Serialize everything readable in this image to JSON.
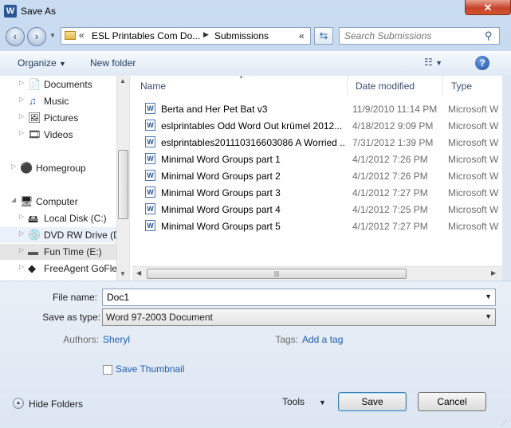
{
  "window": {
    "title": "Save As",
    "app_icon_letter": "W",
    "close_glyph": "✕"
  },
  "address_bar": {
    "chevron": "«",
    "segments": [
      "ESL Printables Com Do...",
      "Submissions"
    ],
    "arrow": "▶",
    "trailing_chevron": "«"
  },
  "search": {
    "placeholder": "Search Submissions"
  },
  "toolbar": {
    "organize_label": "Organize",
    "new_folder_label": "New folder"
  },
  "nav_pane": {
    "items": [
      {
        "label": "Documents",
        "icon": "documents-icon",
        "glyph": "📄"
      },
      {
        "label": "Music",
        "icon": "music-icon",
        "glyph": "♫"
      },
      {
        "label": "Pictures",
        "icon": "pictures-icon",
        "glyph": "🖼"
      },
      {
        "label": "Videos",
        "icon": "videos-icon",
        "glyph": "🎞"
      },
      {
        "label": "Homegroup",
        "icon": "homegroup-icon",
        "glyph": "⚫"
      },
      {
        "label": "Computer",
        "icon": "computer-icon",
        "glyph": "🖥"
      },
      {
        "label": "Local Disk (C:)",
        "icon": "disk-icon",
        "glyph": "🖴"
      },
      {
        "label": "DVD RW Drive (D",
        "icon": "dvd-icon",
        "glyph": "💿"
      },
      {
        "label": "Fun Time (E:)",
        "icon": "drive-icon",
        "glyph": "▬"
      },
      {
        "label": "FreeAgent GoFle:",
        "icon": "external-drive-icon",
        "glyph": "◆"
      }
    ]
  },
  "columns": {
    "name": "Name",
    "date": "Date modified",
    "type": "Type"
  },
  "files": [
    {
      "name": "Berta and Her Pet Bat v3",
      "date": "11/9/2010 11:14 PM",
      "type": "Microsoft W"
    },
    {
      "name": "eslprintables Odd Word Out krümel 2012...",
      "date": "4/18/2012 9:09 PM",
      "type": "Microsoft W"
    },
    {
      "name": "eslprintables201110316603086 A Worried ...",
      "date": "7/31/2012 1:39 PM",
      "type": "Microsoft W"
    },
    {
      "name": "Minimal Word Groups part 1",
      "date": "4/1/2012 7:26 PM",
      "type": "Microsoft W"
    },
    {
      "name": "Minimal Word Groups part 2",
      "date": "4/1/2012 7:26 PM",
      "type": "Microsoft W"
    },
    {
      "name": "Minimal Word Groups part 3",
      "date": "4/1/2012 7:27 PM",
      "type": "Microsoft W"
    },
    {
      "name": "Minimal Word Groups part 4",
      "date": "4/1/2012 7:25 PM",
      "type": "Microsoft W"
    },
    {
      "name": "Minimal Word Groups part 5",
      "date": "4/1/2012 7:27 PM",
      "type": "Microsoft W"
    }
  ],
  "form": {
    "file_name_label": "File name:",
    "file_name_value": "Doc1",
    "save_type_label": "Save as type:",
    "save_type_value": "Word 97-2003 Document",
    "authors_label": "Authors:",
    "authors_value": "Sheryl",
    "tags_label": "Tags:",
    "tags_value": "Add a tag",
    "thumbnail_label": "Save Thumbnail",
    "hide_folders_label": "Hide Folders",
    "tools_label": "Tools",
    "save_label": "Save",
    "cancel_label": "Cancel"
  }
}
